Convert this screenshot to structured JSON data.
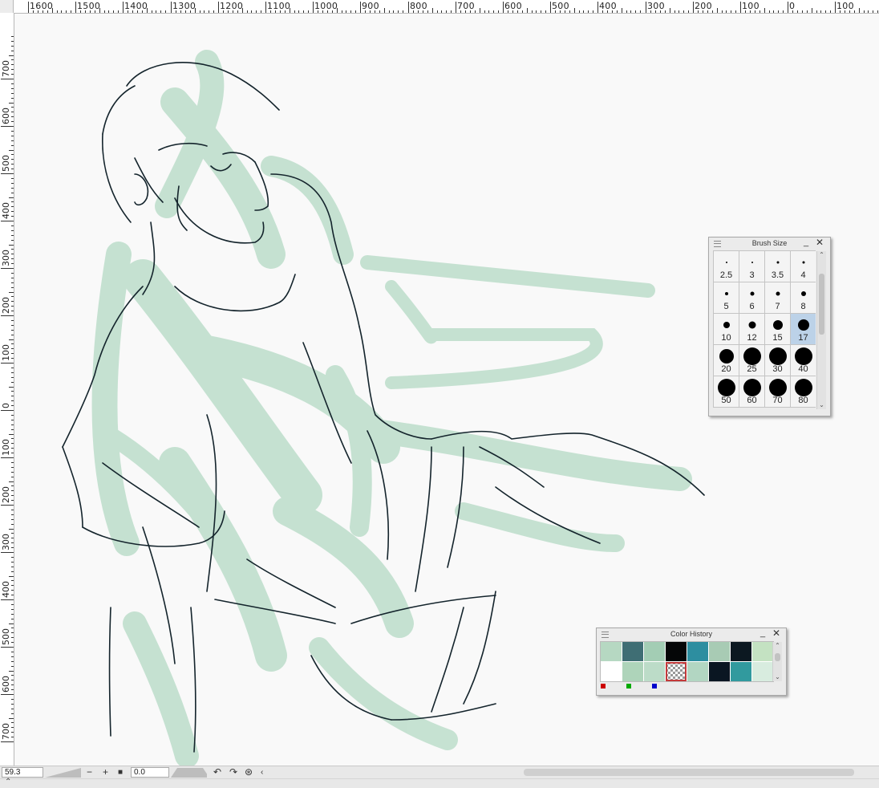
{
  "ruler_top": {
    "labels": [
      "1600",
      "1500",
      "1400",
      "1300",
      "1200",
      "1100",
      "1000",
      "900",
      "800",
      "700",
      "600",
      "500",
      "400",
      "300",
      "200",
      "100",
      "0",
      "100"
    ]
  },
  "ruler_left": {
    "labels": [
      "700",
      "600",
      "500",
      "400",
      "300",
      "200",
      "100",
      "0",
      "100",
      "200",
      "300",
      "400",
      "500",
      "600",
      "700"
    ]
  },
  "brush_palette": {
    "title": "Brush Size",
    "selected_size": "17",
    "sizes": [
      {
        "label": "2.5",
        "dot": 2
      },
      {
        "label": "3",
        "dot": 2
      },
      {
        "label": "3.5",
        "dot": 3
      },
      {
        "label": "4",
        "dot": 3
      },
      {
        "label": "5",
        "dot": 4
      },
      {
        "label": "6",
        "dot": 5
      },
      {
        "label": "7",
        "dot": 5
      },
      {
        "label": "8",
        "dot": 6
      },
      {
        "label": "10",
        "dot": 8
      },
      {
        "label": "12",
        "dot": 9
      },
      {
        "label": "15",
        "dot": 12
      },
      {
        "label": "17",
        "dot": 14
      },
      {
        "label": "20",
        "dot": 18
      },
      {
        "label": "25",
        "dot": 22
      },
      {
        "label": "30",
        "dot": 22
      },
      {
        "label": "40",
        "dot": 22
      },
      {
        "label": "50",
        "dot": 22
      },
      {
        "label": "60",
        "dot": 22
      },
      {
        "label": "70",
        "dot": 22
      },
      {
        "label": "80",
        "dot": 22
      }
    ]
  },
  "color_history": {
    "title": "Color History",
    "swatches": [
      "#b6d8c2",
      "#3f6e74",
      "#a3cdb4",
      "#050607",
      "#2d8ea0",
      "#a8cbb4",
      "#0c1821",
      "#c4e2c2",
      "#ffffff",
      "#aed4ba",
      "#bcdcc8",
      "transparent",
      "#b2d6c2",
      "#0a1622",
      "#319a9e",
      "#d8ecdf"
    ],
    "rgb_marks": [
      "#cc0000",
      "#00aa00",
      "#0000cc"
    ]
  },
  "statusbar": {
    "zoom": "59.3",
    "rotation": "0.0",
    "minus_label": "−",
    "plus_label": "+",
    "stop_label": "■"
  }
}
